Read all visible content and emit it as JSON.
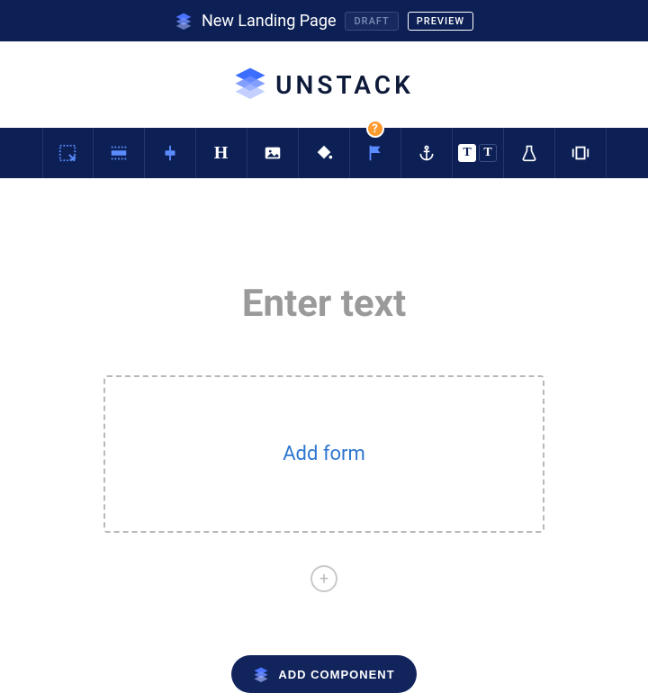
{
  "header": {
    "page_title": "New Landing Page",
    "status_label": "DRAFT",
    "preview_label": "PREVIEW"
  },
  "brand": {
    "name": "UNSTACK"
  },
  "toolbar": {
    "hint_badge": "?"
  },
  "canvas": {
    "placeholder_text": "Enter text",
    "form_drop_label": "Add form",
    "add_circle_glyph": "+"
  },
  "footer": {
    "add_component_label": "ADD COMPONENT"
  },
  "colors": {
    "navy": "#0d2055",
    "accent_orange": "#ff9a2e",
    "link_blue": "#2e77d0"
  }
}
